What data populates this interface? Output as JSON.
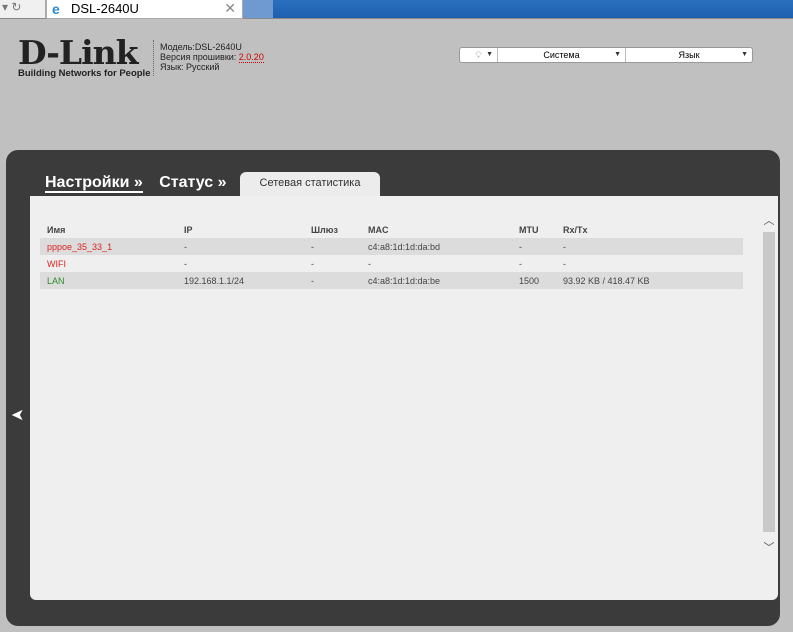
{
  "browser": {
    "tab_title": "DSL-2640U"
  },
  "header": {
    "logo": "D-Link",
    "tagline": "Building Networks for People",
    "model_label": "Модель:",
    "model": "DSL-2640U",
    "fw_label": "Версия прошивки: ",
    "fw": "2.0.20",
    "lang_label": "Язык: ",
    "lang": "Русский"
  },
  "menu": {
    "system": "Система",
    "language": "Язык"
  },
  "breadcrumb": {
    "settings": "Настройки »",
    "status": "Статус »",
    "current_tab": "Сетевая статистика"
  },
  "table": {
    "headers": [
      "Имя",
      "IP",
      "Шлюз",
      "MAC",
      "MTU",
      "Rx/Tx"
    ],
    "rows": [
      {
        "name": "pppoe_35_33_1",
        "ip": "-",
        "gw": "-",
        "mac": "c4:a8:1d:1d:da:bd",
        "mtu": "-",
        "rxtx": "-"
      },
      {
        "name": "WIFI",
        "ip": "-",
        "gw": "-",
        "mac": "-",
        "mtu": "-",
        "rxtx": "-"
      },
      {
        "name": "LAN",
        "ip": "192.168.1.1/24",
        "gw": "-",
        "mac": "c4:a8:1d:1d:da:be",
        "mtu": "1500",
        "rxtx": "93.92 KB / 418.47 KB"
      }
    ]
  }
}
